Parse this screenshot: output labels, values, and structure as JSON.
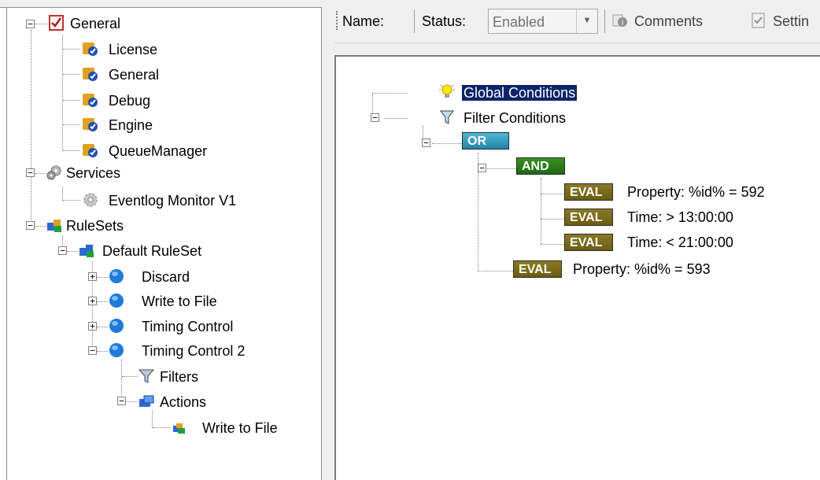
{
  "left_tree": {
    "general": "General",
    "license": "License",
    "general_child": "General",
    "debug": "Debug",
    "engine": "Engine",
    "queue_manager": "QueueManager",
    "services": "Services",
    "eventlog_monitor": "Eventlog Monitor V1",
    "rulesets": "RuleSets",
    "default_ruleset": "Default RuleSet",
    "discard": "Discard",
    "write_to_file": "Write to File",
    "timing_control": "Timing Control",
    "timing_control_2": "Timing Control 2",
    "filters": "Filters",
    "actions": "Actions",
    "write_to_file_action": "Write to File"
  },
  "toolbar": {
    "name_label": "Name:",
    "status_label": "Status:",
    "status_value": "Enabled",
    "comments_label": "Comments",
    "settings_label": "Settin"
  },
  "conditions": {
    "global_conditions": "Global Conditions",
    "filter_conditions": "Filter Conditions",
    "or_tag": "OR",
    "and_tag": "AND",
    "eval_tag": "EVAL",
    "eval1": "Property: %id% = 592",
    "eval2": "Time:  > 13:00:00",
    "eval3": "Time:  < 21:00:00",
    "eval4": "Property: %id% = 593"
  }
}
